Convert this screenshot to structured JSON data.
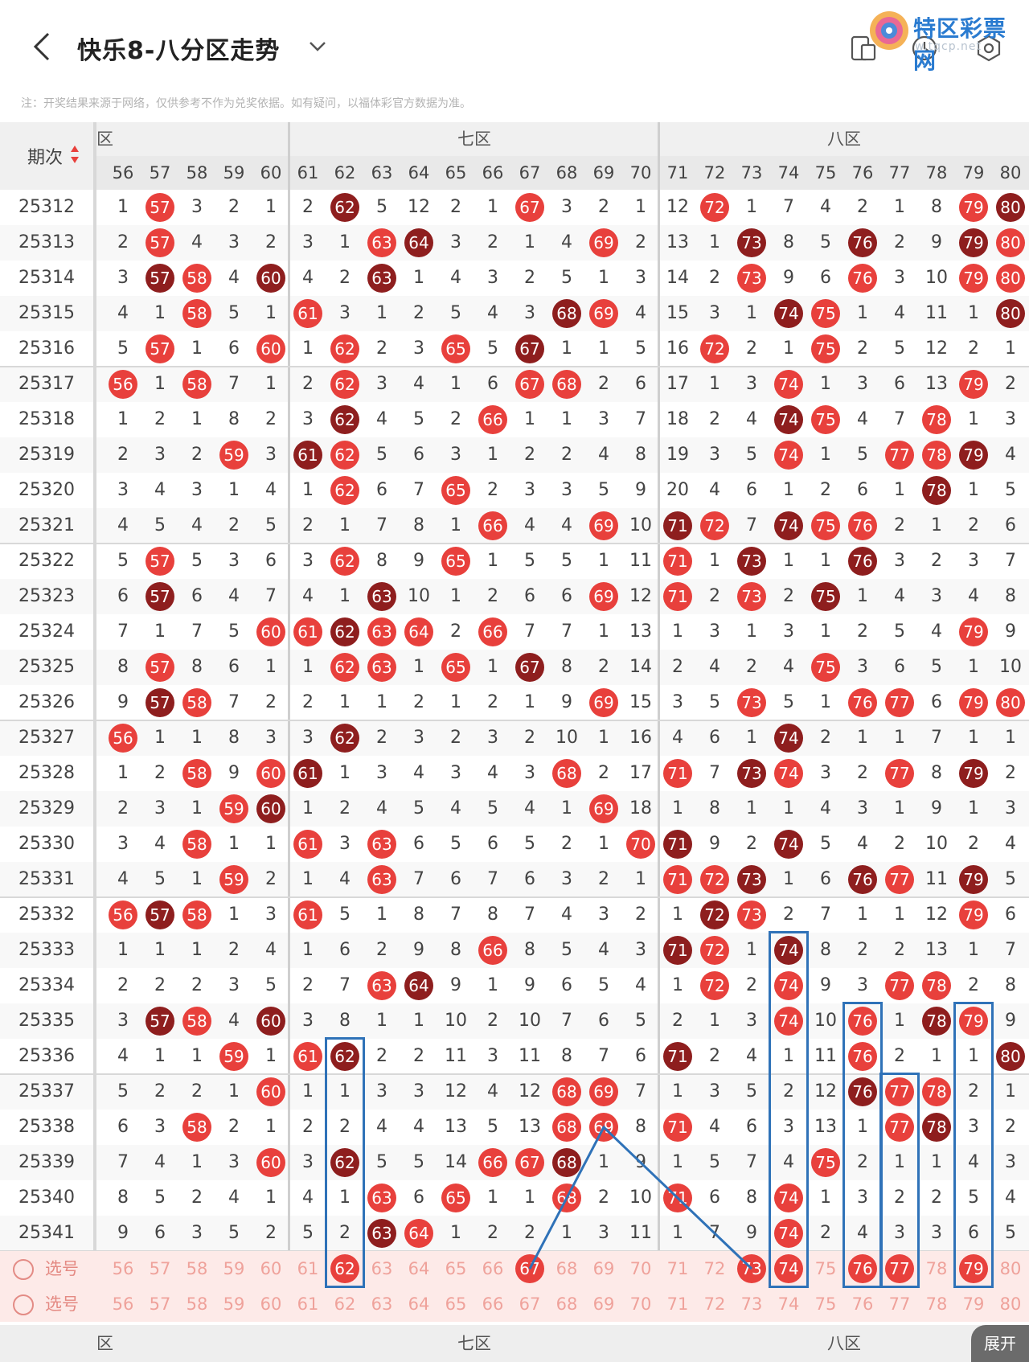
{
  "header": {
    "title": "快乐8-八分区走势",
    "logo_text": "特区彩票网",
    "logo_url": "w.tqcp.net"
  },
  "notice": "注：开奖结果来源于网络，仅供参考不作为兑奖依据。如有疑问，以福体彩官方数据为准。",
  "table": {
    "period_header": "期次",
    "zones": [
      {
        "label": "六区",
        "visible_label": "区"
      },
      {
        "label": "七区"
      },
      {
        "label": "八区"
      }
    ],
    "columns": [
      "56",
      "57",
      "58",
      "59",
      "60",
      "61",
      "62",
      "63",
      "64",
      "65",
      "66",
      "67",
      "68",
      "69",
      "70",
      "71",
      "72",
      "73",
      "74",
      "75",
      "76",
      "77",
      "78",
      "79",
      "80"
    ],
    "rows": [
      {
        "period": "25312",
        "cells": [
          "1",
          "57",
          "3",
          "2",
          "1",
          "2",
          "62",
          "5",
          "12",
          "2",
          "1",
          "67",
          "3",
          "2",
          "1",
          "12",
          "72",
          "1",
          "7",
          "4",
          "2",
          "1",
          "8",
          "79",
          "80"
        ]
      },
      {
        "period": "25313",
        "cells": [
          "2",
          "57",
          "4",
          "3",
          "2",
          "3",
          "1",
          "63",
          "64",
          "3",
          "2",
          "1",
          "4",
          "69",
          "2",
          "13",
          "1",
          "73",
          "8",
          "5",
          "76",
          "2",
          "9",
          "79",
          "80"
        ]
      },
      {
        "period": "25314",
        "cells": [
          "3",
          "57",
          "58",
          "4",
          "60",
          "4",
          "2",
          "63",
          "1",
          "4",
          "3",
          "2",
          "5",
          "1",
          "3",
          "14",
          "2",
          "73",
          "9",
          "6",
          "76",
          "3",
          "10",
          "79",
          "80"
        ]
      },
      {
        "period": "25315",
        "cells": [
          "4",
          "1",
          "58",
          "5",
          "1",
          "61",
          "3",
          "1",
          "2",
          "5",
          "4",
          "3",
          "68",
          "69",
          "4",
          "15",
          "3",
          "1",
          "74",
          "75",
          "1",
          "4",
          "11",
          "1",
          "80"
        ]
      },
      {
        "period": "25316",
        "cells": [
          "5",
          "57",
          "1",
          "6",
          "60",
          "1",
          "62",
          "2",
          "3",
          "65",
          "5",
          "67",
          "1",
          "1",
          "5",
          "16",
          "72",
          "2",
          "1",
          "75",
          "2",
          "5",
          "12",
          "2",
          "1"
        ]
      },
      {
        "period": "25317",
        "cells": [
          "56",
          "1",
          "58",
          "7",
          "1",
          "2",
          "62",
          "3",
          "4",
          "1",
          "6",
          "67",
          "68",
          "2",
          "6",
          "17",
          "1",
          "3",
          "74",
          "1",
          "3",
          "6",
          "13",
          "79",
          "2"
        ]
      },
      {
        "period": "25318",
        "cells": [
          "1",
          "2",
          "1",
          "8",
          "2",
          "3",
          "62",
          "4",
          "5",
          "2",
          "66",
          "1",
          "1",
          "3",
          "7",
          "18",
          "2",
          "4",
          "74",
          "75",
          "4",
          "7",
          "78",
          "1",
          "3"
        ]
      },
      {
        "period": "25319",
        "cells": [
          "2",
          "3",
          "2",
          "59",
          "3",
          "61",
          "62",
          "5",
          "6",
          "3",
          "1",
          "2",
          "2",
          "4",
          "8",
          "19",
          "3",
          "5",
          "74",
          "1",
          "5",
          "77",
          "78",
          "79",
          "4"
        ]
      },
      {
        "period": "25320",
        "cells": [
          "3",
          "4",
          "3",
          "1",
          "4",
          "1",
          "62",
          "6",
          "7",
          "65",
          "2",
          "3",
          "3",
          "5",
          "9",
          "20",
          "4",
          "6",
          "1",
          "2",
          "6",
          "1",
          "78",
          "1",
          "5"
        ]
      },
      {
        "period": "25321",
        "cells": [
          "4",
          "5",
          "4",
          "2",
          "5",
          "2",
          "1",
          "7",
          "8",
          "1",
          "66",
          "4",
          "4",
          "69",
          "10",
          "71",
          "72",
          "7",
          "74",
          "75",
          "76",
          "2",
          "1",
          "2",
          "6"
        ]
      },
      {
        "period": "25322",
        "cells": [
          "5",
          "57",
          "5",
          "3",
          "6",
          "3",
          "62",
          "8",
          "9",
          "65",
          "1",
          "5",
          "5",
          "1",
          "11",
          "71",
          "1",
          "73",
          "1",
          "1",
          "76",
          "3",
          "2",
          "3",
          "7"
        ]
      },
      {
        "period": "25323",
        "cells": [
          "6",
          "57",
          "6",
          "4",
          "7",
          "4",
          "1",
          "63",
          "10",
          "1",
          "2",
          "6",
          "6",
          "69",
          "12",
          "71",
          "2",
          "73",
          "2",
          "75",
          "1",
          "4",
          "3",
          "4",
          "8"
        ]
      },
      {
        "period": "25324",
        "cells": [
          "7",
          "1",
          "7",
          "5",
          "60",
          "61",
          "62",
          "63",
          "64",
          "2",
          "66",
          "7",
          "7",
          "1",
          "13",
          "1",
          "3",
          "1",
          "3",
          "1",
          "2",
          "5",
          "4",
          "79",
          "9"
        ]
      },
      {
        "period": "25325",
        "cells": [
          "8",
          "57",
          "8",
          "6",
          "1",
          "1",
          "62",
          "63",
          "1",
          "65",
          "1",
          "67",
          "8",
          "2",
          "14",
          "2",
          "4",
          "2",
          "4",
          "75",
          "3",
          "6",
          "5",
          "1",
          "10"
        ]
      },
      {
        "period": "25326",
        "cells": [
          "9",
          "57",
          "58",
          "7",
          "2",
          "2",
          "1",
          "1",
          "2",
          "1",
          "2",
          "1",
          "9",
          "69",
          "15",
          "3",
          "5",
          "73",
          "5",
          "1",
          "76",
          "77",
          "6",
          "79",
          "80"
        ]
      },
      {
        "period": "25327",
        "cells": [
          "56",
          "1",
          "1",
          "8",
          "3",
          "3",
          "62",
          "2",
          "3",
          "2",
          "3",
          "2",
          "10",
          "1",
          "16",
          "4",
          "6",
          "1",
          "74",
          "2",
          "1",
          "1",
          "7",
          "1",
          "1"
        ]
      },
      {
        "period": "25328",
        "cells": [
          "1",
          "2",
          "58",
          "9",
          "60",
          "61",
          "1",
          "3",
          "4",
          "3",
          "4",
          "3",
          "68",
          "2",
          "17",
          "71",
          "7",
          "73",
          "74",
          "3",
          "2",
          "77",
          "8",
          "79",
          "2"
        ]
      },
      {
        "period": "25329",
        "cells": [
          "2",
          "3",
          "1",
          "59",
          "60",
          "1",
          "2",
          "4",
          "5",
          "4",
          "5",
          "4",
          "1",
          "69",
          "18",
          "1",
          "8",
          "1",
          "1",
          "4",
          "3",
          "1",
          "9",
          "1",
          "3"
        ]
      },
      {
        "period": "25330",
        "cells": [
          "3",
          "4",
          "58",
          "1",
          "1",
          "61",
          "3",
          "63",
          "6",
          "5",
          "6",
          "5",
          "2",
          "1",
          "70",
          "71",
          "9",
          "2",
          "74",
          "5",
          "4",
          "2",
          "10",
          "2",
          "4"
        ]
      },
      {
        "period": "25331",
        "cells": [
          "4",
          "5",
          "1",
          "59",
          "2",
          "1",
          "4",
          "63",
          "7",
          "6",
          "7",
          "6",
          "3",
          "2",
          "1",
          "71",
          "72",
          "73",
          "1",
          "6",
          "76",
          "77",
          "11",
          "79",
          "5"
        ]
      },
      {
        "period": "25332",
        "cells": [
          "56",
          "57",
          "58",
          "1",
          "3",
          "61",
          "5",
          "1",
          "8",
          "7",
          "8",
          "7",
          "4",
          "3",
          "2",
          "1",
          "72",
          "73",
          "2",
          "7",
          "1",
          "1",
          "12",
          "79",
          "6"
        ]
      },
      {
        "period": "25333",
        "cells": [
          "1",
          "1",
          "1",
          "2",
          "4",
          "1",
          "6",
          "2",
          "9",
          "8",
          "66",
          "8",
          "5",
          "4",
          "3",
          "71",
          "72",
          "1",
          "74",
          "8",
          "2",
          "2",
          "13",
          "1",
          "7"
        ]
      },
      {
        "period": "25334",
        "cells": [
          "2",
          "2",
          "2",
          "3",
          "5",
          "2",
          "7",
          "63",
          "64",
          "9",
          "1",
          "9",
          "6",
          "5",
          "4",
          "1",
          "72",
          "2",
          "74",
          "9",
          "3",
          "77",
          "78",
          "2",
          "8"
        ]
      },
      {
        "period": "25335",
        "cells": [
          "3",
          "57",
          "58",
          "4",
          "60",
          "3",
          "8",
          "1",
          "1",
          "10",
          "2",
          "10",
          "7",
          "6",
          "5",
          "2",
          "1",
          "3",
          "74",
          "10",
          "76",
          "1",
          "78",
          "79",
          "9"
        ]
      },
      {
        "period": "25336",
        "cells": [
          "4",
          "1",
          "1",
          "59",
          "1",
          "61",
          "62",
          "2",
          "2",
          "11",
          "3",
          "11",
          "8",
          "7",
          "6",
          "71",
          "2",
          "4",
          "1",
          "11",
          "76",
          "2",
          "1",
          "1",
          "80"
        ]
      },
      {
        "period": "25337",
        "cells": [
          "5",
          "2",
          "2",
          "1",
          "60",
          "1",
          "1",
          "3",
          "3",
          "12",
          "4",
          "12",
          "68",
          "69",
          "7",
          "1",
          "3",
          "5",
          "2",
          "12",
          "76",
          "77",
          "78",
          "2",
          "1"
        ]
      },
      {
        "period": "25338",
        "cells": [
          "6",
          "3",
          "58",
          "2",
          "1",
          "2",
          "2",
          "4",
          "4",
          "13",
          "5",
          "13",
          "68",
          "69",
          "8",
          "71",
          "4",
          "6",
          "3",
          "13",
          "1",
          "77",
          "78",
          "3",
          "2"
        ]
      },
      {
        "period": "25339",
        "cells": [
          "7",
          "4",
          "1",
          "3",
          "60",
          "3",
          "62",
          "5",
          "5",
          "14",
          "66",
          "67",
          "68",
          "1",
          "9",
          "1",
          "5",
          "7",
          "4",
          "75",
          "2",
          "1",
          "1",
          "4",
          "3"
        ]
      },
      {
        "period": "25340",
        "cells": [
          "8",
          "5",
          "2",
          "4",
          "1",
          "4",
          "1",
          "63",
          "6",
          "65",
          "1",
          "1",
          "68",
          "2",
          "10",
          "71",
          "6",
          "8",
          "74",
          "1",
          "3",
          "2",
          "2",
          "5",
          "4"
        ]
      },
      {
        "period": "25341",
        "cells": [
          "9",
          "6",
          "3",
          "5",
          "2",
          "5",
          "2",
          "63",
          "64",
          "1",
          "2",
          "2",
          "1",
          "3",
          "11",
          "1",
          "7",
          "9",
          "74",
          "2",
          "4",
          "3",
          "3",
          "6",
          "5"
        ]
      }
    ],
    "select_label": "选号",
    "select_rows": [
      {
        "label": "选号",
        "picked": [
          "62",
          "67",
          "73",
          "74",
          "76",
          "77",
          "79"
        ]
      },
      {
        "label": "选号",
        "picked": []
      }
    ],
    "bottom_zones": [
      {
        "label": "六区",
        "visible_label": "区"
      },
      {
        "label": "七区"
      },
      {
        "label": "八区"
      }
    ],
    "expand_label": "展开"
  },
  "colors": {
    "ball_red": "#e8403c",
    "ball_dark": "#8e1e1e",
    "select_bg": "#fdeae8",
    "box_blue": "#2f72b8"
  }
}
